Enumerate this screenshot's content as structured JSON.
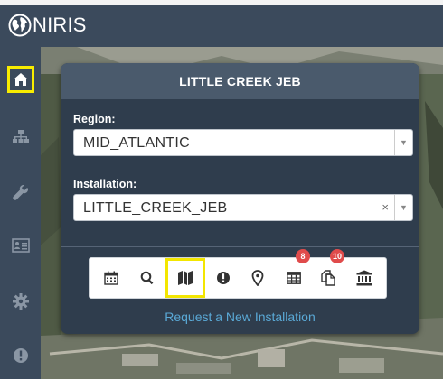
{
  "app": {
    "title": "NIRIS",
    "logo_icon": "globe-icon"
  },
  "colors": {
    "header": "#3b4a5c",
    "panel": "#2f3d4d",
    "panel_title": "#4a5a6c",
    "highlight": "#f3e600",
    "badge": "#e04b4b",
    "link": "#5aa9d6"
  },
  "sidebar": {
    "items": [
      {
        "icon": "home-icon",
        "active": true
      },
      {
        "icon": "sitemap-icon",
        "active": false
      },
      {
        "icon": "wrench-icon",
        "active": false
      },
      {
        "icon": "id-card-icon",
        "active": false
      },
      {
        "icon": "gear-icon",
        "active": false
      },
      {
        "icon": "exclamation-circle-icon",
        "active": false
      }
    ]
  },
  "panel": {
    "title": "LITTLE CREEK JEB",
    "region": {
      "label": "Region:",
      "value": "MID_ATLANTIC"
    },
    "installation": {
      "label": "Installation:",
      "value": "LITTLE_CREEK_JEB",
      "clear": "×"
    },
    "toolbar": [
      {
        "icon": "calendar-icon"
      },
      {
        "icon": "search-icon"
      },
      {
        "icon": "map-icon",
        "selected": true
      },
      {
        "icon": "exclamation-icon"
      },
      {
        "icon": "map-marker-icon"
      },
      {
        "icon": "table-icon",
        "badge": "8"
      },
      {
        "icon": "copy-icon",
        "badge": "10"
      },
      {
        "icon": "bank-icon"
      }
    ],
    "request_link": "Request a New Installation"
  }
}
